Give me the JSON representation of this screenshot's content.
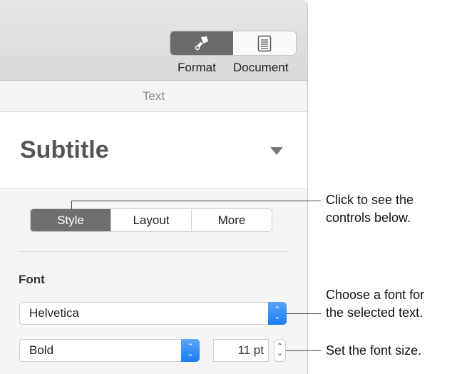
{
  "toolbar": {
    "format_label": "Format",
    "document_label": "Document"
  },
  "section_header": "Text",
  "paragraph_style": "Subtitle",
  "tabs": [
    "Style",
    "Layout",
    "More"
  ],
  "font": {
    "label": "Font",
    "family": "Helvetica",
    "typeface": "Bold",
    "size": "11 pt"
  },
  "callouts": {
    "tabs": [
      "Click to see the",
      "controls below."
    ],
    "font": [
      "Choose a font for",
      "the selected text."
    ],
    "size": "Set the font size."
  },
  "colors": {
    "accent": "#1a7cf4",
    "selected": "#6b6b6b"
  }
}
